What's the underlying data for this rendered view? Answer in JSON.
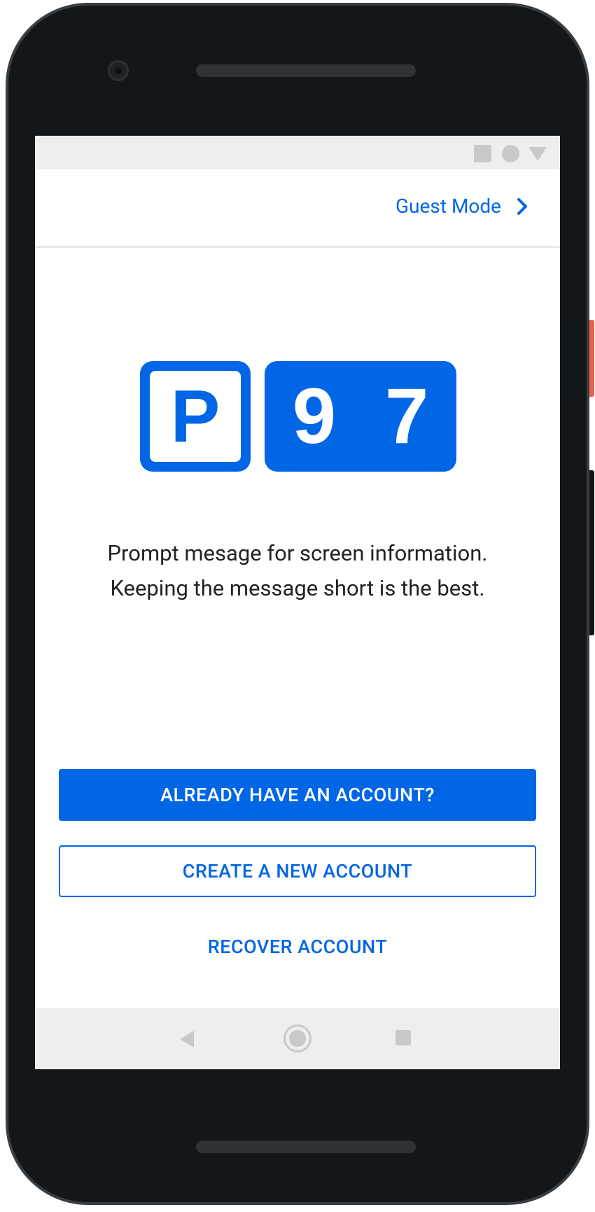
{
  "header": {
    "guest_mode_label": "Guest Mode"
  },
  "logo": {
    "letter": "P",
    "digit_1": "9",
    "digit_2": "7"
  },
  "prompt": {
    "line_1": "Prompt mesage for screen information.",
    "line_2": "Keeping the message short is the best."
  },
  "actions": {
    "primary_label": "ALREADY HAVE AN ACCOUNT?",
    "secondary_label": "CREATE A NEW ACCOUNT",
    "text_label": "RECOVER ACCOUNT"
  },
  "colors": {
    "accent": "#0066e6",
    "device_body": "#141719",
    "system_bar": "#eeeeee",
    "system_icon": "#c9c9c9"
  },
  "icons": {
    "status_bar": [
      "stop-square-icon",
      "record-circle-icon",
      "signal-triangle-icon"
    ],
    "header": "chevron-right-icon",
    "nav_bar": [
      "back-icon",
      "home-icon",
      "recents-icon"
    ]
  }
}
